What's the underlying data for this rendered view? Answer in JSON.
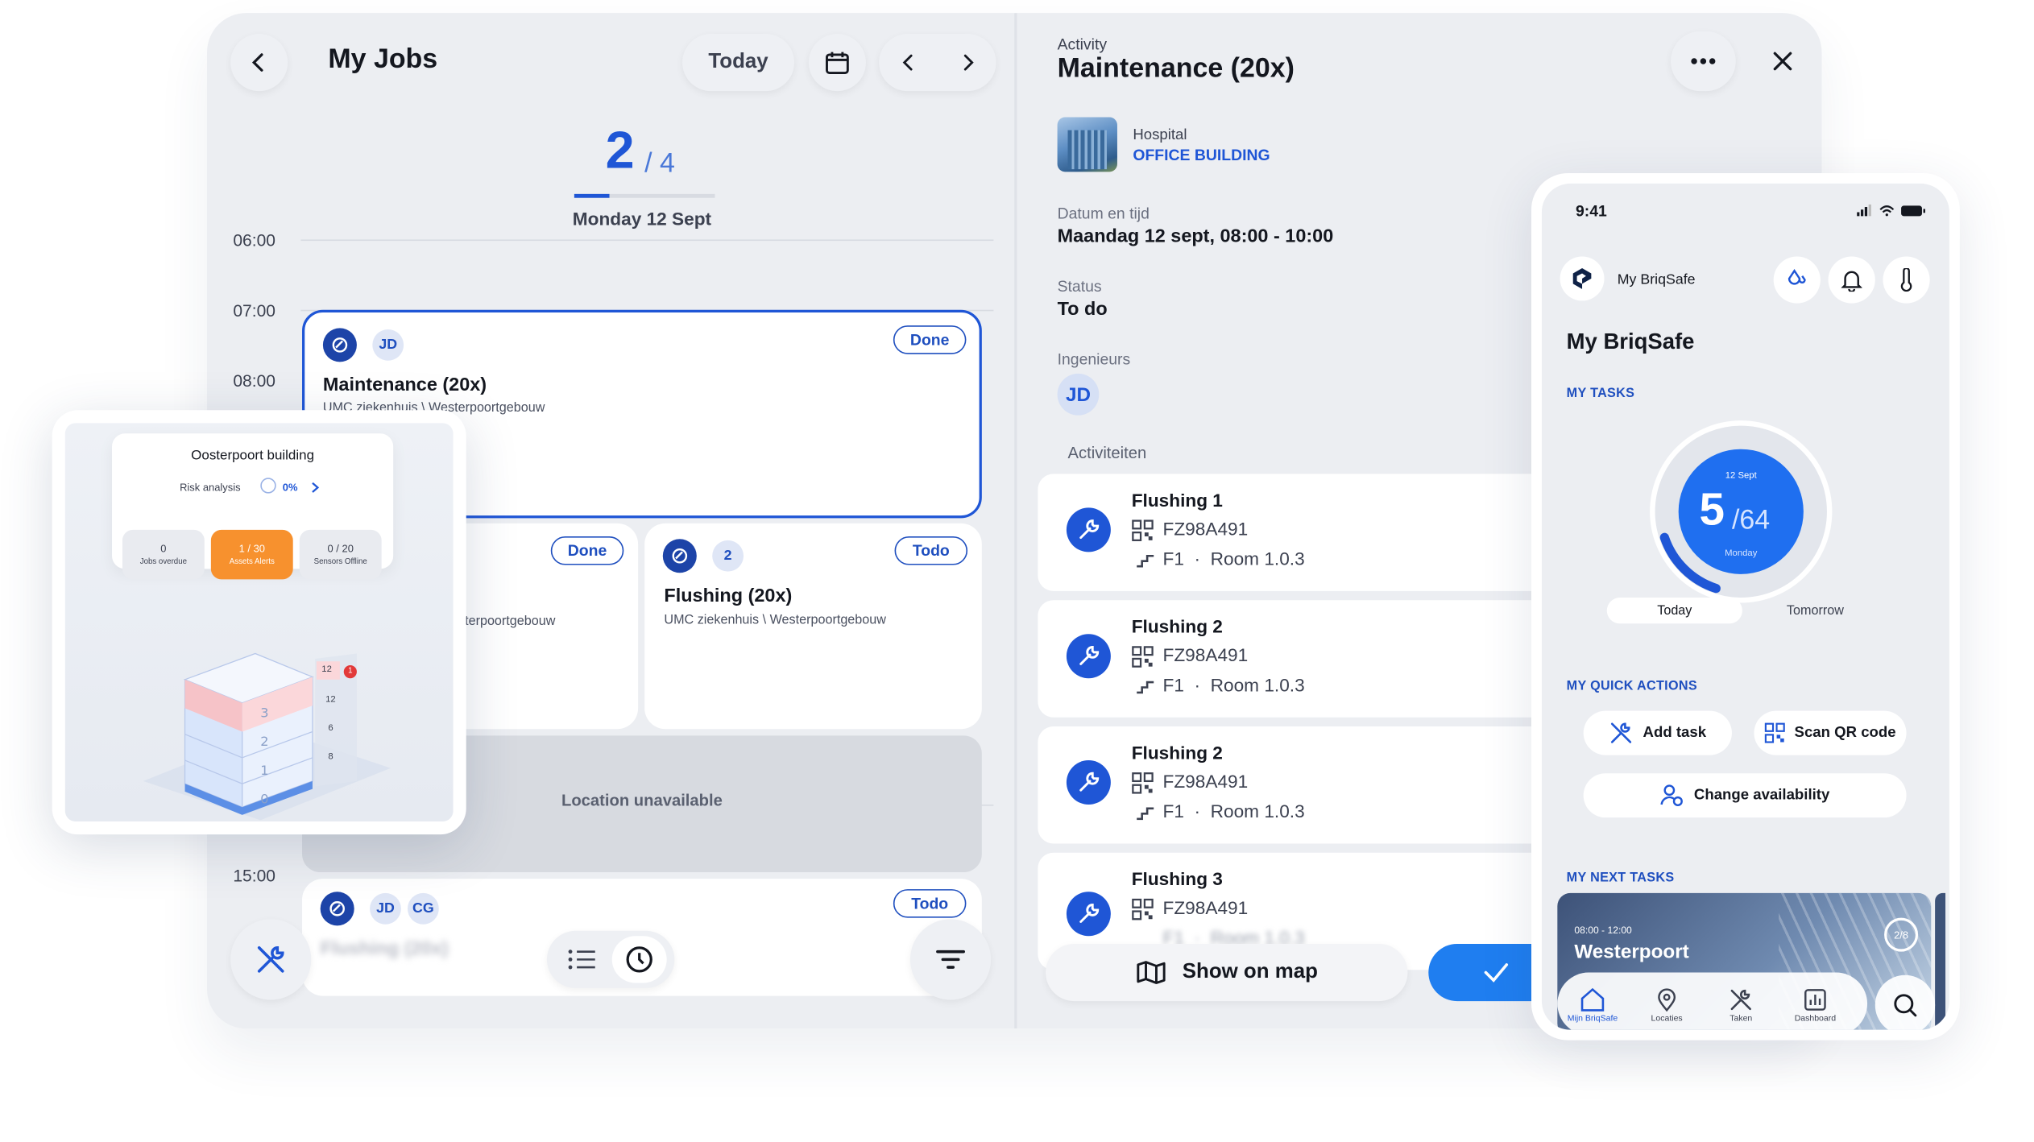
{
  "colors": {
    "accent": "#1f56d6",
    "dark_blue": "#1d44a8",
    "orange": "#f7912e",
    "alert_red": "#e23a3a"
  },
  "jobs": {
    "title": "My Jobs",
    "today_label": "Today",
    "counter_current": "2",
    "counter_total": "/ 4",
    "date": "Monday 12 Sept",
    "hours": [
      "06:00",
      "07:00",
      "08:00",
      "15:00"
    ],
    "card_main": {
      "initials": "JD",
      "status": "Done",
      "title": "Maintenance (20x)",
      "subtitle": "UMC ziekenhuis \\ Westerpoortgebouw"
    },
    "card_left": {
      "status": "Done",
      "subtitle": "sterpoortgebouw"
    },
    "card_right": {
      "count": "2",
      "status": "Todo",
      "title": "Flushing (20x)",
      "subtitle": "UMC ziekenhuis \\ Westerpoortgebouw"
    },
    "unavailable": "Location unavailable",
    "card_bottom": {
      "initials_1": "JD",
      "initials_2": "CG",
      "status": "Todo",
      "title": "Flushing (20x)"
    }
  },
  "detail": {
    "eyebrow": "Activity",
    "title": "Maintenance (20x)",
    "building_type": "Hospital",
    "building_name": "OFFICE BUILDING",
    "datetime_label": "Datum en tijd",
    "datetime_value": "Maandag 12 sept, 08:00 - 10:00",
    "status_label": "Status",
    "status_value": "To do",
    "engineers_label": "Ingenieurs",
    "engineer_initials": "JD",
    "activities_label": "Activiteiten",
    "activities": [
      {
        "name": "Flushing 1",
        "code": "FZ98A491",
        "floor": "F1",
        "room": "Room 1.0.3"
      },
      {
        "name": "Flushing 2",
        "code": "FZ98A491",
        "floor": "F1",
        "room": "Room 1.0.3"
      },
      {
        "name": "Flushing 2",
        "code": "FZ98A491",
        "floor": "F1",
        "room": "Room 1.0.3"
      },
      {
        "name": "Flushing 3",
        "code": "FZ98A491",
        "floor": "F1",
        "room": "Room 1.0.3"
      }
    ],
    "map_button": "Show on map"
  },
  "building_overlay": {
    "title": "Oosterpoort building",
    "risk_label": "Risk analysis",
    "risk_value": "0%",
    "stats": [
      {
        "value": "0",
        "label": "Jobs overdue"
      },
      {
        "value": "1 / 30",
        "label": "Assets Alerts"
      },
      {
        "value": "0 / 20",
        "label": "Sensors Offline"
      }
    ],
    "floors": [
      "3",
      "2",
      "1",
      "0"
    ],
    "counts": [
      "12",
      "12",
      "6",
      "8"
    ],
    "alert_count": "1"
  },
  "phone": {
    "time": "9:41",
    "app_name": "My BriqSafe",
    "heading": "My BriqSafe",
    "my_tasks": "MY TASKS",
    "dial_date": "12 Sept",
    "dial_done": "5",
    "dial_total": "/64",
    "dial_day": "Monday",
    "dial_progress": 0.078,
    "tab_today": "Today",
    "tab_tomorrow": "Tomorrow",
    "quick_actions_title": "MY QUICK ACTIONS",
    "add_task": "Add task",
    "scan_qr": "Scan QR code",
    "change_availability": "Change availability",
    "next_tasks_title": "MY NEXT TASKS",
    "next_time": "08:00 - 12:00",
    "next_location": "Westerpoort",
    "next_progress": "2/8",
    "nav": [
      "Mijn BriqSafe",
      "Locaties",
      "Taken",
      "Dashboard"
    ]
  }
}
